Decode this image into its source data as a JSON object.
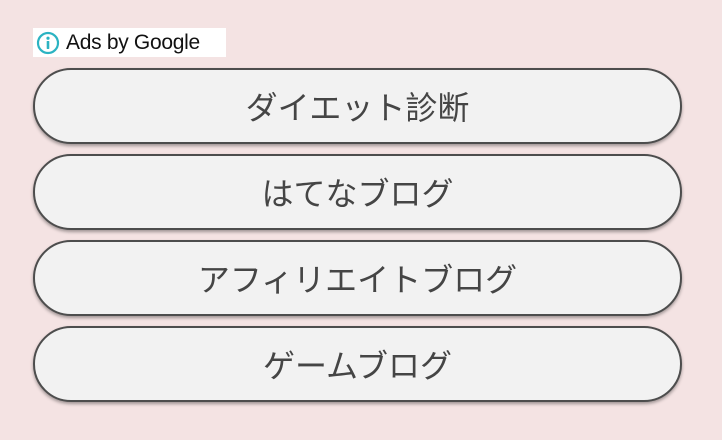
{
  "ads_badge": {
    "icon": "info-icon",
    "icon_color": "#2bb3c2",
    "text": "Ads by Google"
  },
  "ads": [
    {
      "label": "ダイエット診断"
    },
    {
      "label": "はてなブログ"
    },
    {
      "label": "アフィリエイトブログ"
    },
    {
      "label": "ゲームブログ"
    }
  ]
}
